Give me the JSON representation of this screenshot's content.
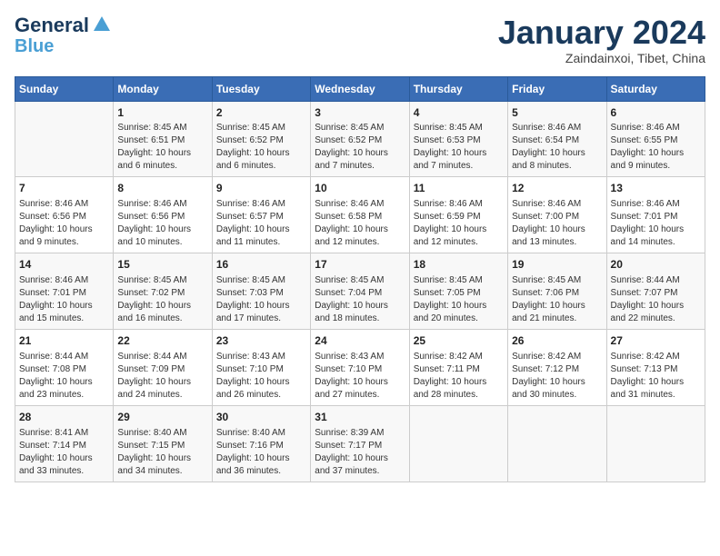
{
  "header": {
    "logo_line1": "General",
    "logo_line2": "Blue",
    "month": "January 2024",
    "location": "Zaindainxoi, Tibet, China"
  },
  "days_of_week": [
    "Sunday",
    "Monday",
    "Tuesday",
    "Wednesday",
    "Thursday",
    "Friday",
    "Saturday"
  ],
  "weeks": [
    [
      {
        "day": "",
        "content": ""
      },
      {
        "day": "1",
        "content": "Sunrise: 8:45 AM\nSunset: 6:51 PM\nDaylight: 10 hours\nand 6 minutes."
      },
      {
        "day": "2",
        "content": "Sunrise: 8:45 AM\nSunset: 6:52 PM\nDaylight: 10 hours\nand 6 minutes."
      },
      {
        "day": "3",
        "content": "Sunrise: 8:45 AM\nSunset: 6:52 PM\nDaylight: 10 hours\nand 7 minutes."
      },
      {
        "day": "4",
        "content": "Sunrise: 8:45 AM\nSunset: 6:53 PM\nDaylight: 10 hours\nand 7 minutes."
      },
      {
        "day": "5",
        "content": "Sunrise: 8:46 AM\nSunset: 6:54 PM\nDaylight: 10 hours\nand 8 minutes."
      },
      {
        "day": "6",
        "content": "Sunrise: 8:46 AM\nSunset: 6:55 PM\nDaylight: 10 hours\nand 9 minutes."
      }
    ],
    [
      {
        "day": "7",
        "content": "Sunrise: 8:46 AM\nSunset: 6:56 PM\nDaylight: 10 hours\nand 9 minutes."
      },
      {
        "day": "8",
        "content": "Sunrise: 8:46 AM\nSunset: 6:56 PM\nDaylight: 10 hours\nand 10 minutes."
      },
      {
        "day": "9",
        "content": "Sunrise: 8:46 AM\nSunset: 6:57 PM\nDaylight: 10 hours\nand 11 minutes."
      },
      {
        "day": "10",
        "content": "Sunrise: 8:46 AM\nSunset: 6:58 PM\nDaylight: 10 hours\nand 12 minutes."
      },
      {
        "day": "11",
        "content": "Sunrise: 8:46 AM\nSunset: 6:59 PM\nDaylight: 10 hours\nand 12 minutes."
      },
      {
        "day": "12",
        "content": "Sunrise: 8:46 AM\nSunset: 7:00 PM\nDaylight: 10 hours\nand 13 minutes."
      },
      {
        "day": "13",
        "content": "Sunrise: 8:46 AM\nSunset: 7:01 PM\nDaylight: 10 hours\nand 14 minutes."
      }
    ],
    [
      {
        "day": "14",
        "content": "Sunrise: 8:46 AM\nSunset: 7:01 PM\nDaylight: 10 hours\nand 15 minutes."
      },
      {
        "day": "15",
        "content": "Sunrise: 8:45 AM\nSunset: 7:02 PM\nDaylight: 10 hours\nand 16 minutes."
      },
      {
        "day": "16",
        "content": "Sunrise: 8:45 AM\nSunset: 7:03 PM\nDaylight: 10 hours\nand 17 minutes."
      },
      {
        "day": "17",
        "content": "Sunrise: 8:45 AM\nSunset: 7:04 PM\nDaylight: 10 hours\nand 18 minutes."
      },
      {
        "day": "18",
        "content": "Sunrise: 8:45 AM\nSunset: 7:05 PM\nDaylight: 10 hours\nand 20 minutes."
      },
      {
        "day": "19",
        "content": "Sunrise: 8:45 AM\nSunset: 7:06 PM\nDaylight: 10 hours\nand 21 minutes."
      },
      {
        "day": "20",
        "content": "Sunrise: 8:44 AM\nSunset: 7:07 PM\nDaylight: 10 hours\nand 22 minutes."
      }
    ],
    [
      {
        "day": "21",
        "content": "Sunrise: 8:44 AM\nSunset: 7:08 PM\nDaylight: 10 hours\nand 23 minutes."
      },
      {
        "day": "22",
        "content": "Sunrise: 8:44 AM\nSunset: 7:09 PM\nDaylight: 10 hours\nand 24 minutes."
      },
      {
        "day": "23",
        "content": "Sunrise: 8:43 AM\nSunset: 7:10 PM\nDaylight: 10 hours\nand 26 minutes."
      },
      {
        "day": "24",
        "content": "Sunrise: 8:43 AM\nSunset: 7:10 PM\nDaylight: 10 hours\nand 27 minutes."
      },
      {
        "day": "25",
        "content": "Sunrise: 8:42 AM\nSunset: 7:11 PM\nDaylight: 10 hours\nand 28 minutes."
      },
      {
        "day": "26",
        "content": "Sunrise: 8:42 AM\nSunset: 7:12 PM\nDaylight: 10 hours\nand 30 minutes."
      },
      {
        "day": "27",
        "content": "Sunrise: 8:42 AM\nSunset: 7:13 PM\nDaylight: 10 hours\nand 31 minutes."
      }
    ],
    [
      {
        "day": "28",
        "content": "Sunrise: 8:41 AM\nSunset: 7:14 PM\nDaylight: 10 hours\nand 33 minutes."
      },
      {
        "day": "29",
        "content": "Sunrise: 8:40 AM\nSunset: 7:15 PM\nDaylight: 10 hours\nand 34 minutes."
      },
      {
        "day": "30",
        "content": "Sunrise: 8:40 AM\nSunset: 7:16 PM\nDaylight: 10 hours\nand 36 minutes."
      },
      {
        "day": "31",
        "content": "Sunrise: 8:39 AM\nSunset: 7:17 PM\nDaylight: 10 hours\nand 37 minutes."
      },
      {
        "day": "",
        "content": ""
      },
      {
        "day": "",
        "content": ""
      },
      {
        "day": "",
        "content": ""
      }
    ]
  ]
}
